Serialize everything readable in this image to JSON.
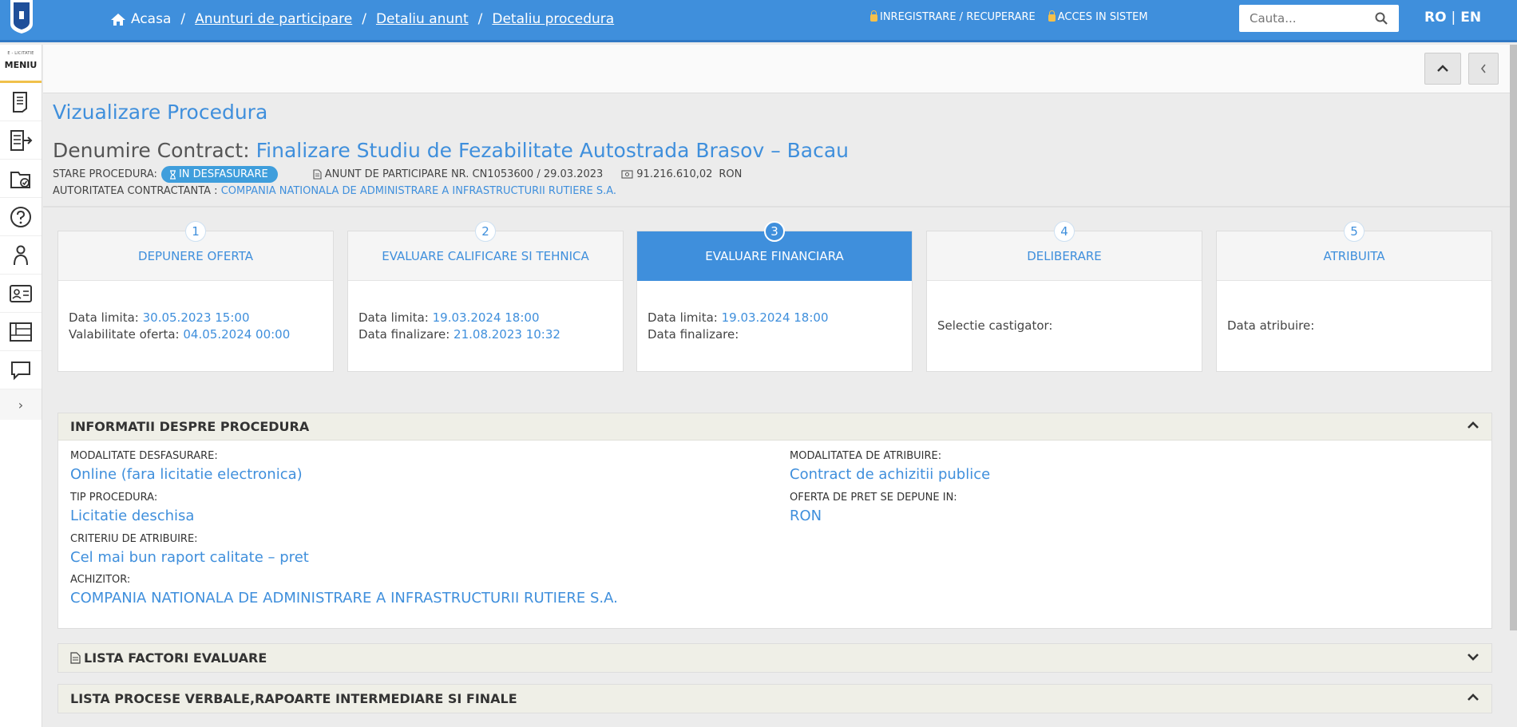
{
  "header": {
    "home_label": "Acasa",
    "crumbs": [
      "Anunturi de participare",
      "Detaliu anunt",
      "Detaliu procedura"
    ],
    "register_label": "INREGISTRARE / RECUPERARE",
    "login_label": "ACCES IN SISTEM",
    "search_placeholder": "Cauta...",
    "lang_ro": "RO",
    "lang_sep": "|",
    "lang_en": "EN"
  },
  "sidebar": {
    "small_label": "E - LICITATIE",
    "menu_label": "MENIU",
    "items": [
      "document-icon",
      "export-list-icon",
      "folder-check-icon",
      "help-icon",
      "user-icon",
      "id-card-icon",
      "gallery-icon",
      "chat-icon"
    ]
  },
  "page": {
    "title": "Vizualizare Procedura",
    "contract_label": "Denumire Contract:",
    "contract_name": "Finalizare Studiu de Fezabilitate Autostrada Brasov – Bacau",
    "status_label": "STARE PROCEDURA:",
    "status_value": "IN DESFASURARE",
    "notice": "ANUNT DE PARTICIPARE NR. CN1053600 / 29.03.2023",
    "amount": "91.216.610,02",
    "currency": "RON",
    "authority_label": "AUTORITATEA CONTRACTANTA :",
    "authority_value": "COMPANIA NATIONALA DE ADMINISTRARE A INFRASTRUCTURII RUTIERE S.A."
  },
  "steps": [
    {
      "num": "1",
      "title": "DEPUNERE OFERTA",
      "l1": "Data limita:",
      "v1": "30.05.2023 15:00",
      "l2": "Valabilitate oferta:",
      "v2": "04.05.2024 00:00"
    },
    {
      "num": "2",
      "title": "EVALUARE CALIFICARE SI TEHNICA",
      "l1": "Data limita:",
      "v1": "19.03.2024 18:00",
      "l2": "Data finalizare:",
      "v2": "21.08.2023 10:32"
    },
    {
      "num": "3",
      "title": "EVALUARE FINANCIARA",
      "l1": "Data limita:",
      "v1": "19.03.2024 18:00",
      "l2": "Data finalizare:",
      "v2": ""
    },
    {
      "num": "4",
      "title": "DELIBERARE",
      "l1": "Selectie castigator:"
    },
    {
      "num": "5",
      "title": "ATRIBUITA",
      "l1": "Data atribuire:"
    }
  ],
  "info": {
    "title": "INFORMATII DESPRE PROCEDURA",
    "modalitate_label": "MODALITATE DESFASURARE:",
    "modalitate_value": "Online (fara licitatie electronica)",
    "tip_label": "TIP PROCEDURA:",
    "tip_value": "Licitatie deschisa",
    "criteriu_label": "CRITERIU DE ATRIBUIRE:",
    "criteriu_value": "Cel mai bun raport calitate – pret",
    "achizitor_label": "ACHIZITOR:",
    "achizitor_value": "COMPANIA NATIONALA DE ADMINISTRARE A INFRASTRUCTURII RUTIERE S.A.",
    "atribuire_label": "MODALITATEA DE ATRIBUIRE:",
    "atribuire_value": "Contract de achizitii publice",
    "oferta_label": "OFERTA DE PRET SE DEPUNE IN:",
    "oferta_value": "RON"
  },
  "sections": {
    "factori": "LISTA FACTORI EVALUARE",
    "procese": "LISTA PROCESE VERBALE,RAPOARTE INTERMEDIARE SI FINALE"
  },
  "colors": {
    "accent": "#3f8fdc",
    "header_bar": "#3f8fdc",
    "sidebar_highlight": "#f0c14b"
  }
}
